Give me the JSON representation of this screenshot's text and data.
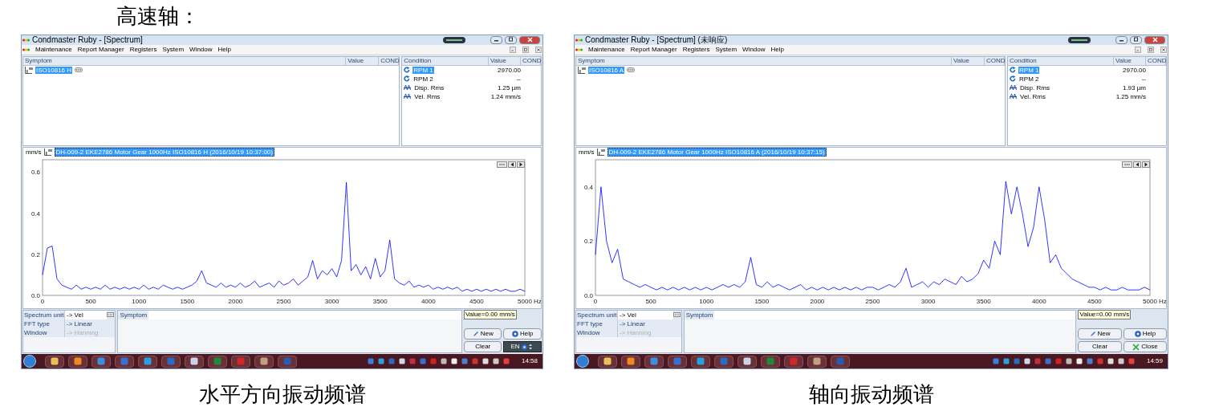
{
  "page_heading": "高速轴：",
  "screenshots": [
    {
      "window": {
        "title": "Condmaster Ruby - [Spectrum]"
      },
      "menu": [
        "Maintenance",
        "Report Manager",
        "Registers",
        "System",
        "Window",
        "Help"
      ],
      "symptom_panel": {
        "columns": [
          "Symptom",
          "Value",
          "COND"
        ],
        "items": [
          {
            "label": "ISO10816 H",
            "selected": true
          }
        ]
      },
      "condition_panel": {
        "columns": [
          "Condition",
          "Value",
          "COND"
        ],
        "rows": [
          {
            "kind": "rpm",
            "name": "RPM 1",
            "value": "2970.00",
            "selected": true
          },
          {
            "kind": "rpm",
            "name": "RPM 2",
            "value": "--",
            "selected": false
          },
          {
            "kind": "wave",
            "name": "Disp. Rms",
            "value": "1.25 µm",
            "selected": false
          },
          {
            "kind": "wave",
            "name": "Vel. Rms",
            "value": "1.24 mm/s",
            "selected": false
          }
        ]
      },
      "spectrum": {
        "label": "DH-009-2  EKE2786 Motor Gear 1000Hz  ISO10816 H (2016/10/19 10:37:00)",
        "chart_data": {
          "type": "line",
          "xlabel": "Hz",
          "ylabel": "mm/s",
          "xlim": [
            0,
            5000
          ],
          "ylim": [
            0,
            0.66
          ],
          "xticks": [
            0,
            500,
            1000,
            1500,
            2000,
            2500,
            3000,
            3500,
            4000,
            4500,
            5000
          ],
          "yticks": [
            {
              "value": 0,
              "label": "0.0"
            },
            {
              "value": 0.2,
              "label": "0.2"
            },
            {
              "value": 0.4,
              "label": "0.4"
            },
            {
              "value": 0.6,
              "label": "0.6"
            }
          ],
          "x": [
            0,
            50,
            100,
            150,
            200,
            250,
            300,
            350,
            400,
            450,
            500,
            550,
            600,
            650,
            700,
            750,
            800,
            850,
            900,
            950,
            1000,
            1050,
            1100,
            1150,
            1200,
            1250,
            1300,
            1350,
            1400,
            1450,
            1500,
            1550,
            1600,
            1650,
            1700,
            1750,
            1800,
            1850,
            1900,
            1950,
            2000,
            2050,
            2100,
            2150,
            2200,
            2250,
            2300,
            2350,
            2400,
            2450,
            2500,
            2550,
            2600,
            2650,
            2700,
            2750,
            2800,
            2850,
            2900,
            2950,
            3000,
            3050,
            3100,
            3150,
            3200,
            3250,
            3300,
            3350,
            3400,
            3450,
            3500,
            3550,
            3600,
            3650,
            3700,
            3750,
            3800,
            3850,
            3900,
            3950,
            4000,
            4050,
            4100,
            4150,
            4200,
            4250,
            4300,
            4350,
            4400,
            4450,
            4500,
            4550,
            4600,
            4650,
            4700,
            4750,
            4800,
            4850,
            4900,
            4950,
            5000
          ],
          "series": [
            {
              "color": "#0000ff",
              "values": [
                0.1,
                0.23,
                0.24,
                0.08,
                0.05,
                0.04,
                0.03,
                0.05,
                0.03,
                0.04,
                0.03,
                0.04,
                0.03,
                0.05,
                0.03,
                0.04,
                0.03,
                0.04,
                0.03,
                0.04,
                0.03,
                0.05,
                0.03,
                0.04,
                0.03,
                0.05,
                0.04,
                0.03,
                0.04,
                0.03,
                0.04,
                0.05,
                0.07,
                0.12,
                0.06,
                0.05,
                0.04,
                0.06,
                0.04,
                0.05,
                0.04,
                0.06,
                0.04,
                0.05,
                0.07,
                0.04,
                0.05,
                0.06,
                0.04,
                0.07,
                0.05,
                0.06,
                0.08,
                0.05,
                0.07,
                0.09,
                0.17,
                0.08,
                0.12,
                0.1,
                0.13,
                0.09,
                0.17,
                0.55,
                0.12,
                0.15,
                0.1,
                0.14,
                0.08,
                0.18,
                0.09,
                0.12,
                0.27,
                0.08,
                0.06,
                0.05,
                0.07,
                0.04,
                0.05,
                0.04,
                0.05,
                0.03,
                0.04,
                0.03,
                0.04,
                0.03,
                0.04,
                0.02,
                0.03,
                0.02,
                0.03,
                0.02,
                0.03,
                0.02,
                0.03,
                0.02,
                0.03,
                0.02,
                0.02,
                0.03,
                0.02
              ]
            }
          ]
        }
      },
      "settings": [
        {
          "label": "Spectrum unit",
          "value": "-> Vel",
          "disabled": false
        },
        {
          "label": "FFT type",
          "value": "-> Linear",
          "disabled": false
        },
        {
          "label": "Window",
          "value": "-> Hanning",
          "disabled": true
        }
      ],
      "symptom_box": {
        "header": "Symptom"
      },
      "value_tip": "Value=0.00 mm/s",
      "buttons": [
        {
          "kind": "new",
          "label": "New"
        },
        {
          "kind": "help",
          "label": "Help"
        },
        {
          "kind": "clear",
          "label": "Clear"
        }
      ],
      "language_bar": {
        "label": "EN"
      },
      "taskbar": {
        "time": "14:58"
      },
      "caption": "水平方向振动频谱"
    },
    {
      "window": {
        "title": "Condmaster Ruby - [Spectrum] (未响应)"
      },
      "menu": [
        "Maintenance",
        "Report Manager",
        "Registers",
        "System",
        "Window",
        "Help"
      ],
      "symptom_panel": {
        "columns": [
          "Symptom",
          "Value",
          "COND"
        ],
        "items": [
          {
            "label": "ISO10816 A",
            "selected": true
          }
        ]
      },
      "condition_panel": {
        "columns": [
          "Condition",
          "Value",
          "COND"
        ],
        "rows": [
          {
            "kind": "rpm",
            "name": "RPM 1",
            "value": "2970.00",
            "selected": true
          },
          {
            "kind": "rpm",
            "name": "RPM 2",
            "value": "--",
            "selected": false
          },
          {
            "kind": "wave",
            "name": "Disp. Rms",
            "value": "1.93 µm",
            "selected": false
          },
          {
            "kind": "wave",
            "name": "Vel. Rms",
            "value": "1.25 mm/s",
            "selected": false
          }
        ]
      },
      "spectrum": {
        "label": "DH-009-2  EKE2786 Motor Gear 1000Hz  ISO10816 A (2016/10/19 10:37:15)",
        "chart_data": {
          "type": "line",
          "xlabel": "Hz",
          "ylabel": "mm/s",
          "xlim": [
            0,
            5000
          ],
          "ylim": [
            0,
            0.5
          ],
          "xticks": [
            0,
            500,
            1000,
            1500,
            2000,
            2500,
            3000,
            3500,
            4000,
            4500,
            5000
          ],
          "yticks": [
            {
              "value": 0,
              "label": "0.0"
            },
            {
              "value": 0.2,
              "label": "0.2"
            },
            {
              "value": 0.4,
              "label": "0.4"
            }
          ],
          "x": [
            0,
            50,
            100,
            150,
            200,
            250,
            300,
            350,
            400,
            450,
            500,
            550,
            600,
            650,
            700,
            750,
            800,
            850,
            900,
            950,
            1000,
            1050,
            1100,
            1150,
            1200,
            1250,
            1300,
            1350,
            1400,
            1450,
            1500,
            1550,
            1600,
            1650,
            1700,
            1750,
            1800,
            1850,
            1900,
            1950,
            2000,
            2050,
            2100,
            2150,
            2200,
            2250,
            2300,
            2350,
            2400,
            2450,
            2500,
            2550,
            2600,
            2650,
            2700,
            2750,
            2800,
            2850,
            2900,
            2950,
            3000,
            3050,
            3100,
            3150,
            3200,
            3250,
            3300,
            3350,
            3400,
            3450,
            3500,
            3550,
            3600,
            3650,
            3700,
            3750,
            3800,
            3850,
            3900,
            3950,
            4000,
            4050,
            4100,
            4150,
            4200,
            4250,
            4300,
            4350,
            4400,
            4450,
            4500,
            4550,
            4600,
            4650,
            4700,
            4750,
            4800,
            4850,
            4900,
            4950,
            5000
          ],
          "series": [
            {
              "color": "#0000ff",
              "values": [
                0.15,
                0.4,
                0.2,
                0.12,
                0.17,
                0.06,
                0.05,
                0.04,
                0.03,
                0.04,
                0.03,
                0.02,
                0.03,
                0.02,
                0.03,
                0.02,
                0.03,
                0.02,
                0.03,
                0.02,
                0.03,
                0.02,
                0.03,
                0.04,
                0.03,
                0.04,
                0.03,
                0.05,
                0.14,
                0.04,
                0.03,
                0.05,
                0.03,
                0.04,
                0.03,
                0.02,
                0.03,
                0.04,
                0.02,
                0.03,
                0.02,
                0.03,
                0.02,
                0.03,
                0.02,
                0.03,
                0.02,
                0.03,
                0.02,
                0.03,
                0.03,
                0.02,
                0.03,
                0.04,
                0.03,
                0.05,
                0.1,
                0.03,
                0.04,
                0.05,
                0.03,
                0.05,
                0.04,
                0.06,
                0.05,
                0.04,
                0.07,
                0.05,
                0.06,
                0.08,
                0.13,
                0.1,
                0.2,
                0.15,
                0.42,
                0.3,
                0.4,
                0.3,
                0.18,
                0.25,
                0.4,
                0.28,
                0.12,
                0.15,
                0.1,
                0.08,
                0.06,
                0.05,
                0.04,
                0.03,
                0.03,
                0.02,
                0.03,
                0.02,
                0.02,
                0.03,
                0.02,
                0.02,
                0.02,
                0.03,
                0.02
              ]
            }
          ]
        }
      },
      "settings": [
        {
          "label": "Spectrum unit",
          "value": "-> Vel",
          "disabled": false
        },
        {
          "label": "FFT type",
          "value": "-> Linear",
          "disabled": false
        },
        {
          "label": "Window",
          "value": "-> Hanning",
          "disabled": true
        }
      ],
      "symptom_box": {
        "header": "Symptom"
      },
      "value_tip": "Value=0.00 mm/s",
      "buttons": [
        {
          "kind": "new",
          "label": "New"
        },
        {
          "kind": "help",
          "label": "Help"
        },
        {
          "kind": "clear",
          "label": "Clear"
        },
        {
          "kind": "close",
          "label": "Close"
        }
      ],
      "taskbar": {
        "time": "14:59"
      },
      "caption": "轴向振动频谱"
    }
  ]
}
